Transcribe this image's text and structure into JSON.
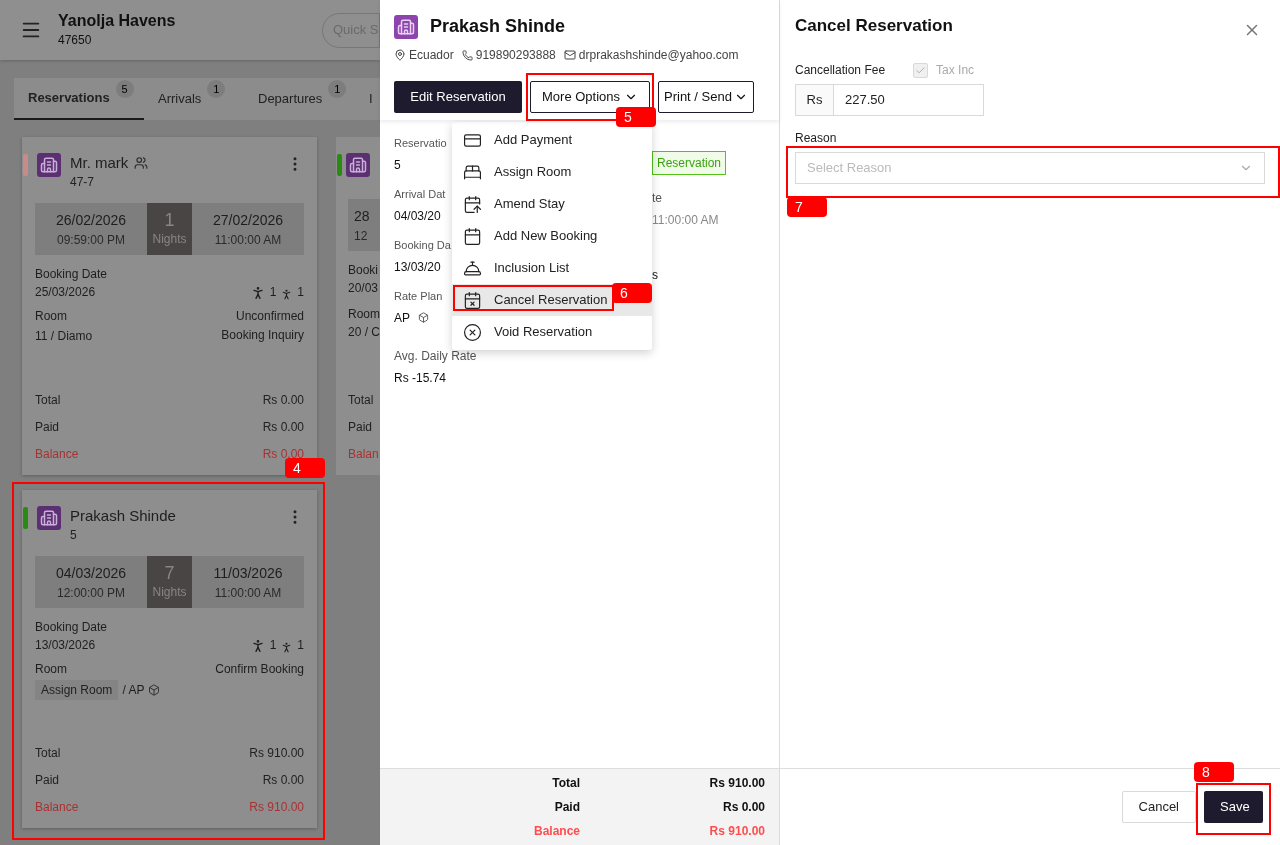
{
  "header": {
    "title": "Yanolja Havens",
    "subtitle": "47650",
    "search_placeholder": "Quick S"
  },
  "tabs": [
    {
      "label": "Reservations",
      "count": "5",
      "selected": true
    },
    {
      "label": "Arrivals",
      "count": "1",
      "selected": false
    },
    {
      "label": "Departures",
      "count": "1",
      "selected": false
    },
    {
      "label": "I",
      "selected": false
    }
  ],
  "cards": [
    {
      "name": "Mr. mark",
      "group": true,
      "code": "47-7",
      "color": "#c98a8a",
      "arrival_date": "26/02/2026",
      "arrival_time": "09:59:00 PM",
      "nights": "1",
      "nights_label": "Nights",
      "departure_date": "27/02/2026",
      "departure_time": "11:00:00 AM",
      "booking_label": "Booking Date",
      "booking_date": "25/03/2026",
      "adults": "1",
      "children": "1",
      "room_label": "Room",
      "room": "11 / Diamo",
      "status": [
        "Unconfirmed",
        "Booking Inquiry"
      ],
      "totals": [
        {
          "label": "Total",
          "value": "Rs 0.00",
          "kind": "plain"
        },
        {
          "label": "Paid",
          "value": "Rs 0.00",
          "kind": "plain"
        },
        {
          "label": "Balance",
          "value": "Rs 0.00",
          "kind": "due"
        }
      ]
    },
    {
      "name": "Prakash Shinde",
      "group": false,
      "code": "5",
      "color": "#2a8a12",
      "annotation": "4",
      "arrival_date": "04/03/2026",
      "arrival_time": "12:00:00 PM",
      "nights": "7",
      "nights_label": "Nights",
      "departure_date": "11/03/2026",
      "departure_time": "11:00:00 AM",
      "booking_label": "Booking Date",
      "booking_date": "13/03/2026",
      "adults": "1",
      "children": "1",
      "room_label": "Room",
      "room_button": "Assign Room",
      "room": "/ AP",
      "room_plan_icon": true,
      "status": [
        "Confirm Booking"
      ],
      "totals": [
        {
          "label": "Total",
          "value": "Rs 910.00",
          "kind": "plain"
        },
        {
          "label": "Paid",
          "value": "Rs 0.00",
          "kind": "plain"
        },
        {
          "label": "Balance",
          "value": "Rs 910.00",
          "kind": "due"
        }
      ]
    }
  ],
  "partial_card": {
    "color": "#2a8a12",
    "arrival_date": "28",
    "arrival_time": "12",
    "booking_label": "Booki",
    "booking_date": "20/03",
    "room_label": "Room",
    "room": "20 / C",
    "totals": [
      {
        "label": "Total",
        "kind": "plain"
      },
      {
        "label": "Paid",
        "kind": "plain"
      },
      {
        "label": "Balan",
        "kind": "due"
      }
    ]
  },
  "detail": {
    "guest": "Prakash Shinde",
    "country": "Ecuador",
    "phone": "919890293888",
    "email": "drprakashshinde@yahoo.com",
    "buttons": [
      {
        "label": "Edit Reservation",
        "kind": "primary"
      },
      {
        "label": "More Options",
        "kind": "dropdown",
        "annotation": "5"
      },
      {
        "label": "Print / Send",
        "kind": "dropdown"
      }
    ],
    "fields_left": [
      {
        "label": "Reservatio",
        "value": "5"
      },
      {
        "label": "Arrival Dat",
        "value": "04/03/20"
      },
      {
        "label": "Booking Da",
        "value": "13/03/20"
      },
      {
        "label": "Rate Plan",
        "value": "AP",
        "plan_icon": true
      }
    ],
    "avg_rate": {
      "label": "Avg. Daily Rate",
      "value": "Rs -15.74"
    },
    "status_badge": "Reservation",
    "fields_right": [
      {
        "label": "te",
        "value": "11:00:00 AM"
      },
      {
        "value": "s"
      }
    ],
    "menu": [
      {
        "label": "Add Payment",
        "kind": "payment",
        "selected": false
      },
      {
        "label": "Assign Room",
        "kind": "room",
        "selected": false
      },
      {
        "label": "Amend Stay",
        "kind": "amend",
        "selected": false
      },
      {
        "label": "Add New Booking",
        "kind": "booking",
        "selected": false
      },
      {
        "label": "Inclusion List",
        "kind": "inclusion",
        "selected": false
      },
      {
        "label": "Cancel Reservation",
        "kind": "cancel",
        "annotation": "6",
        "selected": true
      },
      {
        "label": "Void Reservation",
        "kind": "void",
        "selected": false
      }
    ],
    "totals": [
      {
        "label": "Total",
        "value": "Rs 910.00",
        "kind": "plain"
      },
      {
        "label": "Paid",
        "value": "Rs 0.00",
        "kind": "plain"
      },
      {
        "label": "Balance",
        "value": "Rs 910.00",
        "kind": "due"
      }
    ]
  },
  "cancel_panel": {
    "title": "Cancel Reservation",
    "fee_label": "Cancellation Fee",
    "tax_inc": {
      "label": "Tax Inc",
      "checked": true,
      "disabled": true
    },
    "currency": "Rs",
    "fee": "227.50",
    "reason_label": "Reason",
    "reason_placeholder": "Select Reason",
    "reason_annotation": "7",
    "buttons": [
      {
        "label": "Cancel",
        "kind": "secondary"
      },
      {
        "label": "Save",
        "kind": "primary",
        "annotation": "8"
      }
    ]
  }
}
